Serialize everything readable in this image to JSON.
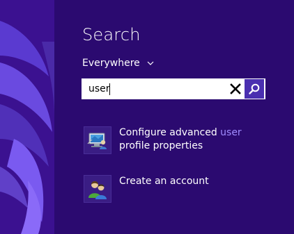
{
  "charm": {
    "title": "Search",
    "scope_label": "Everywhere"
  },
  "search": {
    "query": "user"
  },
  "results": [
    {
      "label_before": "Configure advanced ",
      "label_highlight": "user",
      "label_after": " profile properties",
      "icon": "user-profile-properties-icon"
    },
    {
      "label_before": "Create an account",
      "label_highlight": "",
      "label_after": "",
      "icon": "user-accounts-icon"
    }
  ],
  "colors": {
    "charm_background": "#2b0a70",
    "accent": "#4a2fb0",
    "highlight_text": "#a08cff",
    "left_background": "#3b1190"
  }
}
